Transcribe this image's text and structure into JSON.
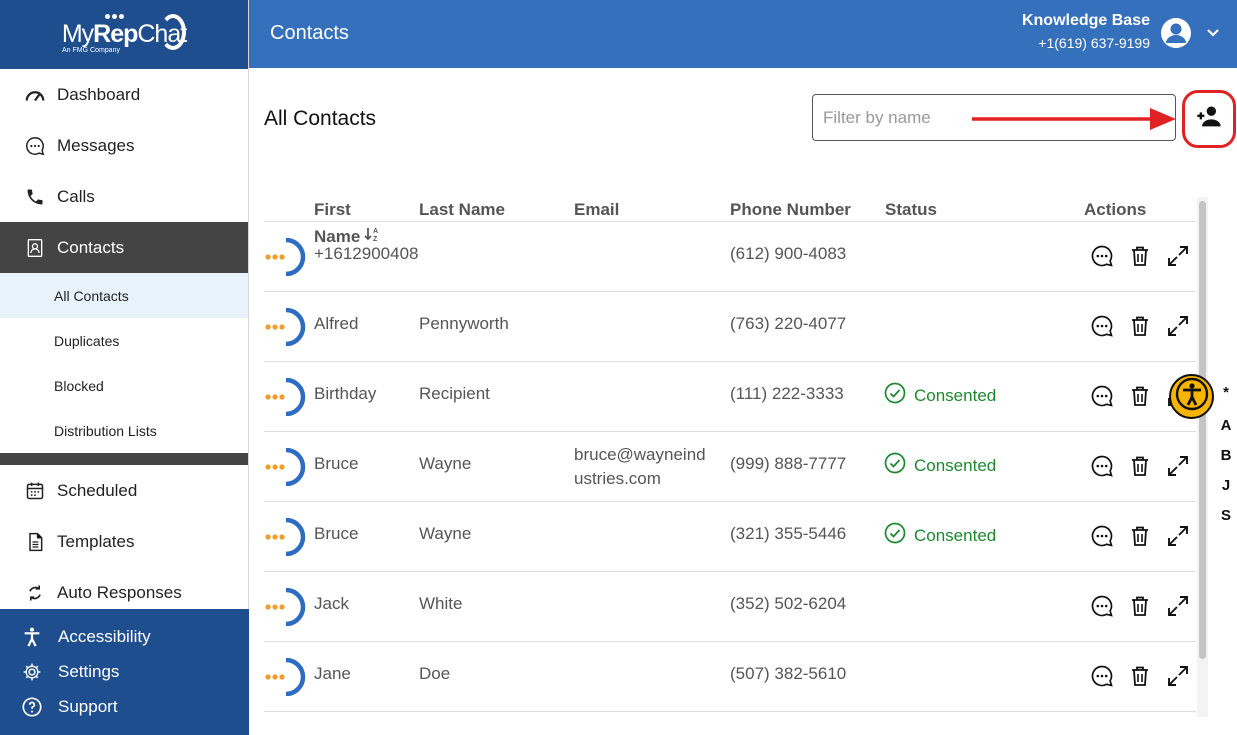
{
  "brand": {
    "name_light": "My",
    "name_bold": "Rep",
    "name_tail": "Chat",
    "tagline": "An FMG Company"
  },
  "sidebar": {
    "items": [
      {
        "label": "Dashboard",
        "icon": "speedometer-icon"
      },
      {
        "label": "Messages",
        "icon": "chat-bubble-icon"
      },
      {
        "label": "Calls",
        "icon": "phone-icon"
      },
      {
        "label": "Contacts",
        "icon": "contacts-icon"
      }
    ],
    "contacts_sub": [
      {
        "label": "All Contacts"
      },
      {
        "label": "Duplicates"
      },
      {
        "label": "Blocked"
      },
      {
        "label": "Distribution Lists"
      }
    ],
    "items_after": [
      {
        "label": "Scheduled",
        "icon": "calendar-icon"
      },
      {
        "label": "Templates",
        "icon": "document-icon"
      },
      {
        "label": "Auto Responses",
        "icon": "refresh-icon"
      }
    ],
    "bottom": [
      {
        "label": "Accessibility",
        "icon": "accessibility-icon"
      },
      {
        "label": "Settings",
        "icon": "gear-icon"
      },
      {
        "label": "Support",
        "icon": "help-icon"
      }
    ]
  },
  "header": {
    "title": "Contacts",
    "account_name": "Knowledge Base",
    "account_phone": "+1(619) 637-9199"
  },
  "main": {
    "title": "All Contacts",
    "filter_placeholder": "Filter by name",
    "columns": {
      "first": "First",
      "first_line2": "Name",
      "last": "Last Name",
      "email": "Email",
      "phone": "Phone Number",
      "status": "Status",
      "actions": "Actions"
    },
    "rows": [
      {
        "first": "+1612900408",
        "last": "",
        "email": "",
        "phone": "(612) 900-4083",
        "status": ""
      },
      {
        "first": "Alfred",
        "last": "Pennyworth",
        "email": "",
        "phone": "(763) 220-4077",
        "status": ""
      },
      {
        "first": "Birthday",
        "last": "Recipient",
        "email": "",
        "phone": "(111) 222-3333",
        "status": "Consented"
      },
      {
        "first": "Bruce",
        "last": "Wayne",
        "email": "bruce@wayneind",
        "email2": "ustries.com",
        "phone": "(999) 888-7777",
        "status": "Consented"
      },
      {
        "first": "Bruce",
        "last": "Wayne",
        "email": "",
        "phone": "(321) 355-5446",
        "status": "Consented"
      },
      {
        "first": "Jack",
        "last": "White",
        "email": "",
        "phone": "(352) 502-6204",
        "status": ""
      },
      {
        "first": "Jane",
        "last": "Doe",
        "email": "",
        "phone": "(507) 382-5610",
        "status": ""
      }
    ]
  },
  "alpha_index": [
    "*",
    "A",
    "B",
    "J",
    "S"
  ],
  "colors": {
    "brand_dark": "#1f4e8f",
    "brand": "#3570bc",
    "consented": "#1b8a2e",
    "highlight": "#e02222",
    "accessibility_badge": "#f7b500"
  }
}
